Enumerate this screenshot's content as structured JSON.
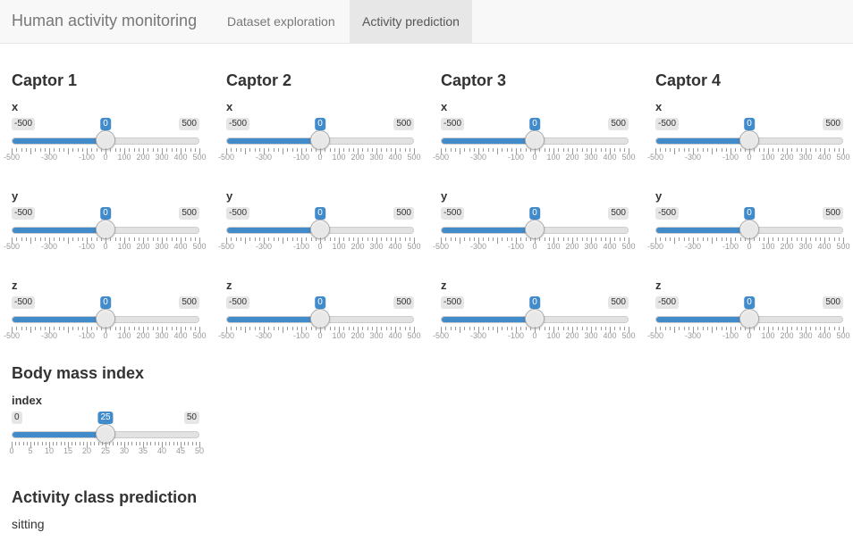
{
  "navbar": {
    "brand": "Human activity monitoring",
    "tabs": [
      {
        "label": "Dataset exploration",
        "active": false
      },
      {
        "label": "Activity prediction",
        "active": true
      }
    ]
  },
  "captors": [
    {
      "title": "Captor 1",
      "sliders": [
        {
          "label": "x",
          "min": -500,
          "max": 500,
          "value": 0
        },
        {
          "label": "y",
          "min": -500,
          "max": 500,
          "value": 0
        },
        {
          "label": "z",
          "min": -500,
          "max": 500,
          "value": 0
        }
      ]
    },
    {
      "title": "Captor 2",
      "sliders": [
        {
          "label": "x",
          "min": -500,
          "max": 500,
          "value": 0
        },
        {
          "label": "y",
          "min": -500,
          "max": 500,
          "value": 0
        },
        {
          "label": "z",
          "min": -500,
          "max": 500,
          "value": 0
        }
      ]
    },
    {
      "title": "Captor 3",
      "sliders": [
        {
          "label": "x",
          "min": -500,
          "max": 500,
          "value": 0
        },
        {
          "label": "y",
          "min": -500,
          "max": 500,
          "value": 0
        },
        {
          "label": "z",
          "min": -500,
          "max": 500,
          "value": 0
        }
      ]
    },
    {
      "title": "Captor 4",
      "sliders": [
        {
          "label": "x",
          "min": -500,
          "max": 500,
          "value": 0
        },
        {
          "label": "y",
          "min": -500,
          "max": 500,
          "value": 0
        },
        {
          "label": "z",
          "min": -500,
          "max": 500,
          "value": 0
        }
      ]
    }
  ],
  "captor_tick_labels": [
    "-500",
    "-300",
    "-100",
    "0",
    "100",
    "200",
    "300",
    "400",
    "500"
  ],
  "bmi": {
    "title": "Body mass index",
    "slider": {
      "label": "index",
      "min": 0,
      "max": 50,
      "value": 25
    },
    "tick_labels": [
      "0",
      "5",
      "10",
      "15",
      "20",
      "25",
      "30",
      "35",
      "40",
      "45",
      "50"
    ]
  },
  "prediction": {
    "title": "Activity class prediction",
    "value": "sitting"
  },
  "colors": {
    "accent": "#428bca",
    "track": "#e2e2e2"
  }
}
